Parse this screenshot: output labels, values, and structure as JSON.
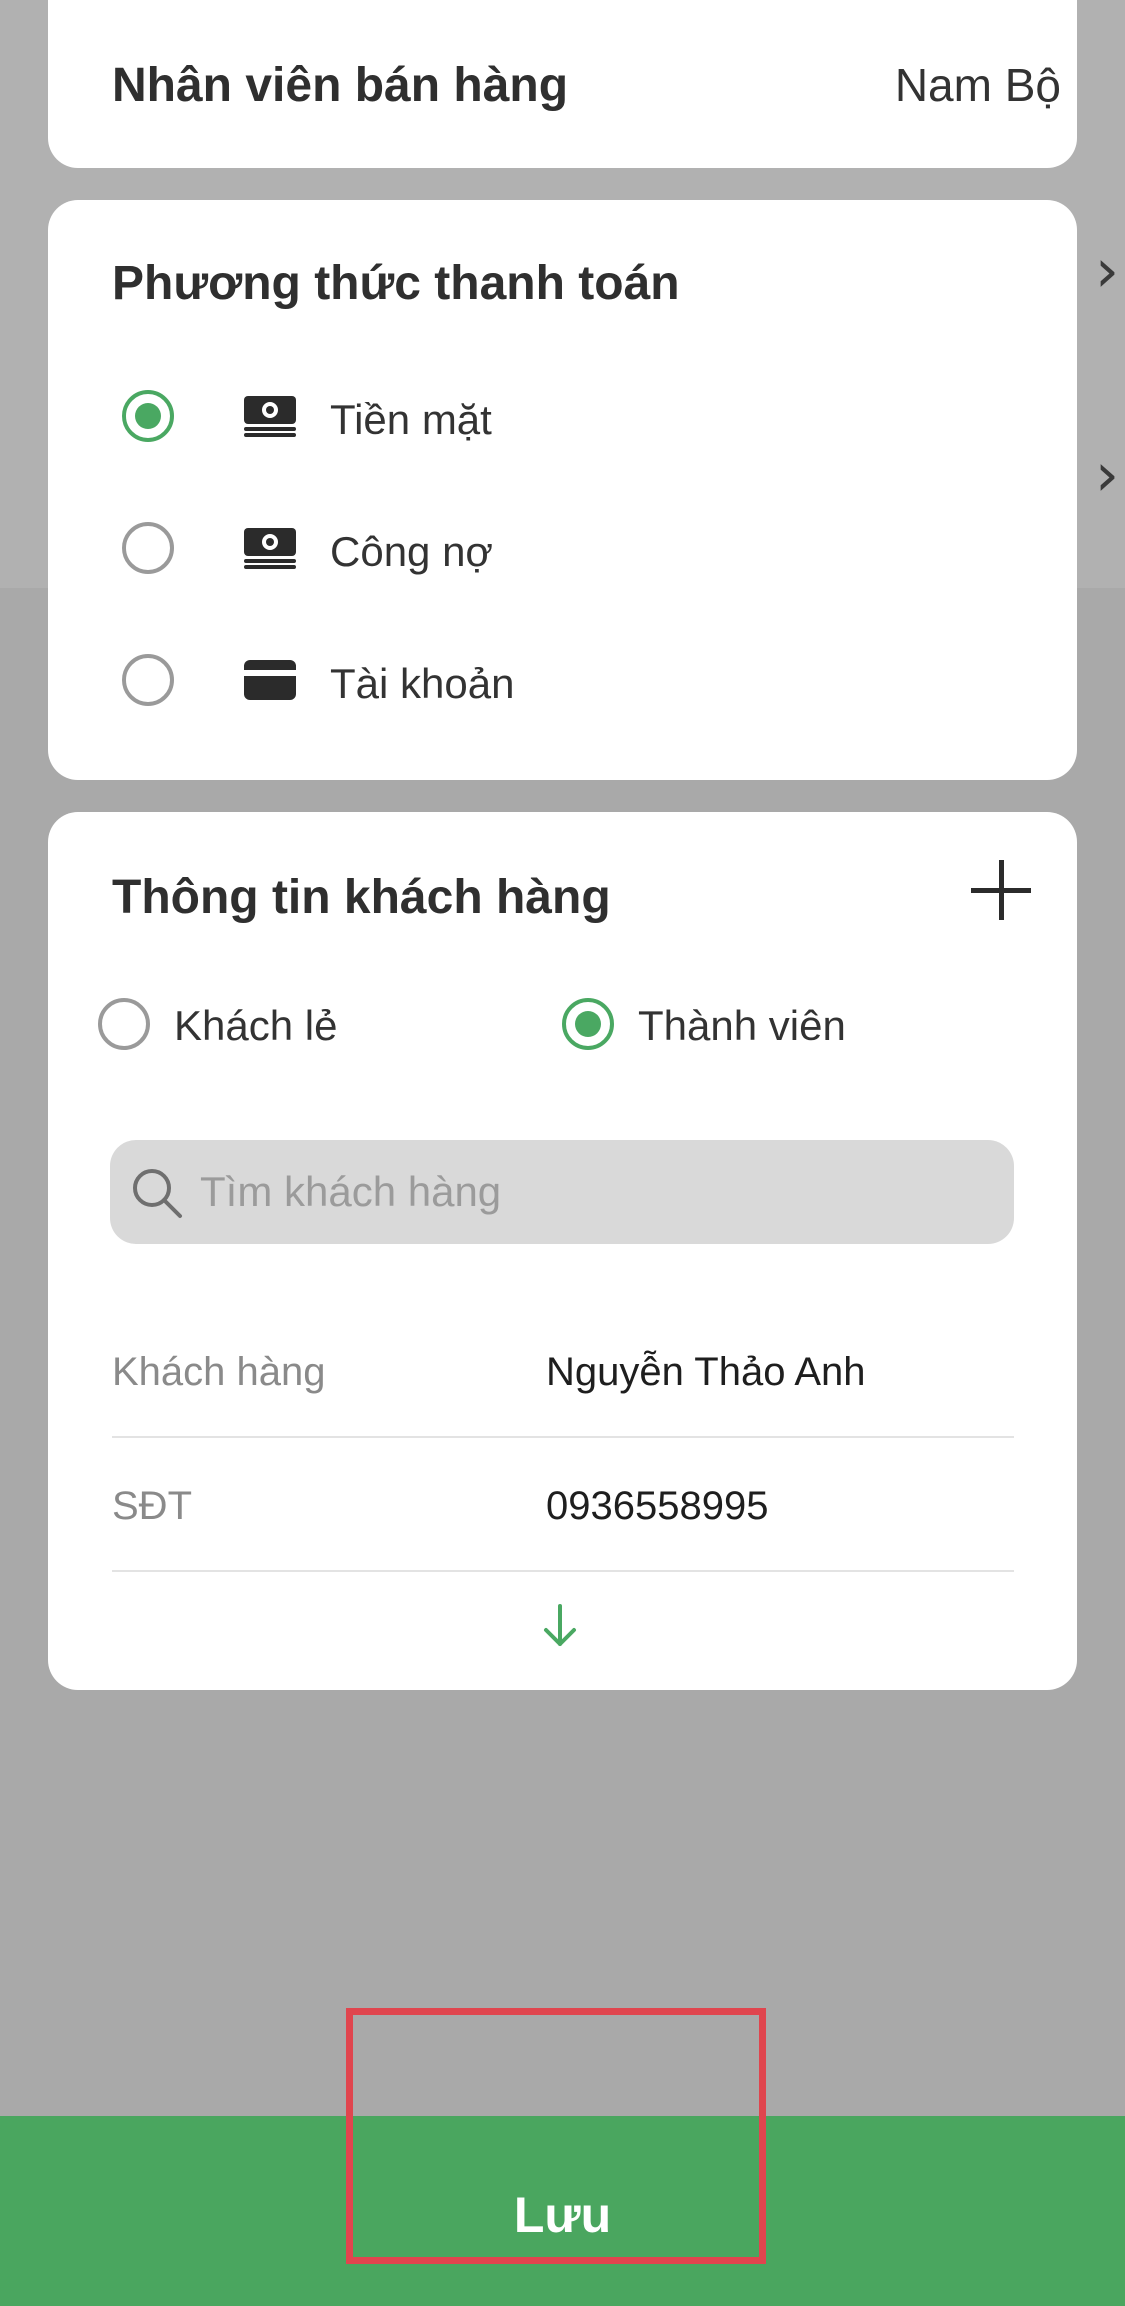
{
  "staff": {
    "label": "Nhân viên bán hàng",
    "value": "Nam Bộ"
  },
  "payment": {
    "title": "Phương thức thanh toán",
    "options": [
      {
        "label": "Tiền mặt",
        "icon": "cash-icon",
        "selected": true
      },
      {
        "label": "Công nợ",
        "icon": "cash-icon",
        "selected": false
      },
      {
        "label": "Tài khoản",
        "icon": "card-icon",
        "selected": false
      }
    ]
  },
  "customer": {
    "title": "Thông tin khách hàng",
    "types": [
      {
        "label": "Khách lẻ",
        "selected": false
      },
      {
        "label": "Thành viên",
        "selected": true
      }
    ],
    "search_placeholder": "Tìm khách hàng",
    "rows": [
      {
        "key": "Khách hàng",
        "value": "Nguyễn Thảo Anh"
      },
      {
        "key": "SĐT",
        "value": "0936558995"
      }
    ]
  },
  "save_label": "Lưu",
  "colors": {
    "accent": "#4aa862",
    "save_bar": "#4aa65f",
    "highlight": "#e0454e",
    "overlay": "#a9a9a9"
  }
}
